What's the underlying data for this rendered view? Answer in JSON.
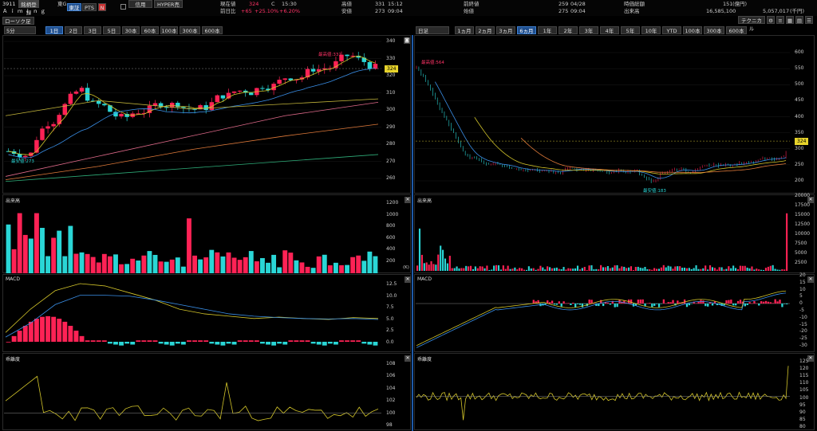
{
  "header": {
    "code": "3911",
    "name": "Ａｉｍｉｎｇ",
    "btn_board": "銘柄登録",
    "market": "東G",
    "btn_tse": "東証",
    "btn_pts": "PTS",
    "btn_n": "N",
    "btn_margin": "信用",
    "btn_hyper": "HYPER売",
    "price_label": "現在値",
    "price": "324",
    "price_flag": "C",
    "price_time": "15:30",
    "change_label": "前日比",
    "change": "+65",
    "change_pct": "+25.10%",
    "change_pct2": "+6.20%",
    "high_label": "高値",
    "high": "331",
    "high_time": "15:12",
    "low_label": "安値",
    "low": "273",
    "low_time": "09:04",
    "prev_label": "前終値",
    "prev": "259",
    "prev_date": "04/28",
    "open_label": "始値",
    "open": "275",
    "open_time": "09:04",
    "mcap_label": "時価総額",
    "mcap": "151",
    "mcap_unit": "(億円)",
    "vol_label": "出来高",
    "vol": "16,585,100",
    "value": "5,057,017",
    "value_unit": "(千円)",
    "chart_type": "ローソク足",
    "tech_btn": "テクニカル"
  },
  "left": {
    "interval": "5分",
    "tabs": [
      "1日",
      "2日",
      "3日",
      "5日",
      "30本",
      "60本",
      "100本",
      "300本",
      "600本"
    ],
    "selected_tab": 0,
    "price_axis": [
      "340",
      "330",
      "320",
      "310",
      "300",
      "290",
      "280",
      "270",
      "260"
    ],
    "current": "324",
    "high_note": "最高値:331",
    "low_note": "最安値:273",
    "vol_label": "出来高",
    "vol_axis": [
      "1200",
      "1000",
      "800",
      "600",
      "400",
      "200"
    ],
    "vol_unit": "(K)",
    "macd_label": "MACD",
    "macd_axis": [
      "12.5",
      "10.0",
      "7.5",
      "5.0",
      "2.5",
      "0.0"
    ],
    "rate_label": "乖離度",
    "rate_axis": [
      "108",
      "106",
      "104",
      "102",
      "100",
      "98"
    ]
  },
  "right": {
    "interval": "日足",
    "tabs": [
      "1ヵ月",
      "2ヵ月",
      "3ヵ月",
      "6ヵ月",
      "1年",
      "2年",
      "3年",
      "4年",
      "5年",
      "10年",
      "YTD",
      "100本",
      "300本",
      "600本"
    ],
    "selected_tab": 3,
    "price_axis": [
      "600",
      "550",
      "500",
      "450",
      "400",
      "350",
      "300",
      "250",
      "200"
    ],
    "current": "324",
    "high_note": "最高値:564",
    "low_note": "最安値:183",
    "vol_label": "出来高",
    "vol_axis": [
      "20000",
      "17500",
      "15000",
      "12500",
      "10000",
      "7500",
      "5000",
      "2500"
    ],
    "macd_label": "MACD",
    "macd_axis": [
      "20",
      "15",
      "10",
      "5",
      "0",
      "-5",
      "-10",
      "-15",
      "-20",
      "-25",
      "-30"
    ],
    "rate_label": "乖離度",
    "rate_axis": [
      "125",
      "120",
      "115",
      "110",
      "105",
      "100",
      "95",
      "90",
      "85",
      "80"
    ]
  },
  "colors": {
    "up": "#ff2255",
    "down": "#2ad6d6",
    "ma5": "#d4c62a",
    "ma25": "#3a8fe8",
    "ma75": "#c2b43a",
    "ma100": "#e06a8a",
    "ma200": "#e07a3a",
    "ma300": "#2fae7a",
    "hl": "#e6d32b"
  }
}
